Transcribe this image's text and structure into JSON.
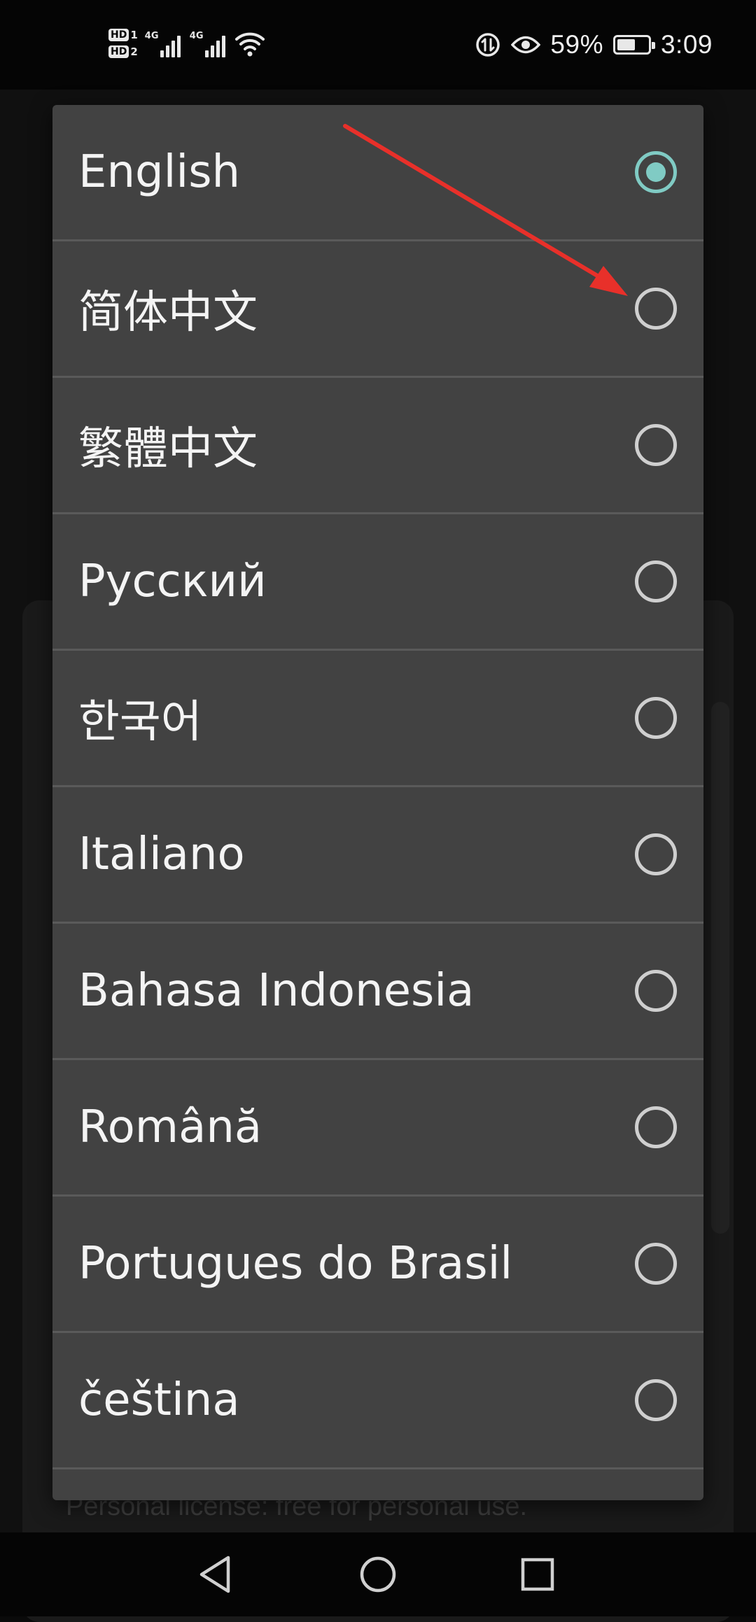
{
  "status_bar": {
    "sim1_label": "HD",
    "sim1_num": "1",
    "sim2_label": "HD",
    "sim2_num": "2",
    "network1": "4G",
    "network2": "4G",
    "battery_percent": "59%",
    "battery_level": 0.59,
    "time": "3:09",
    "icons": [
      "hd-icon",
      "signal-icon",
      "wifi-icon",
      "data-saver-icon",
      "eye-comfort-icon",
      "battery-icon"
    ]
  },
  "background": {
    "footer_text": "Personal license: free for personal use."
  },
  "language_dialog": {
    "selected": "English",
    "options": [
      {
        "label": "English",
        "checked": true
      },
      {
        "label": "简体中文",
        "checked": false
      },
      {
        "label": "繁體中文",
        "checked": false
      },
      {
        "label": "Русский",
        "checked": false
      },
      {
        "label": "한국어",
        "checked": false
      },
      {
        "label": "Italiano",
        "checked": false
      },
      {
        "label": "Bahasa Indonesia",
        "checked": false
      },
      {
        "label": "Română",
        "checked": false
      },
      {
        "label": "Portugues do Brasil",
        "checked": false
      },
      {
        "label": "čeština",
        "checked": false
      }
    ]
  },
  "annotation": {
    "arrow_color": "#e8302a"
  },
  "nav_bar": {
    "icons": [
      "back-icon",
      "home-icon",
      "recents-icon"
    ]
  }
}
